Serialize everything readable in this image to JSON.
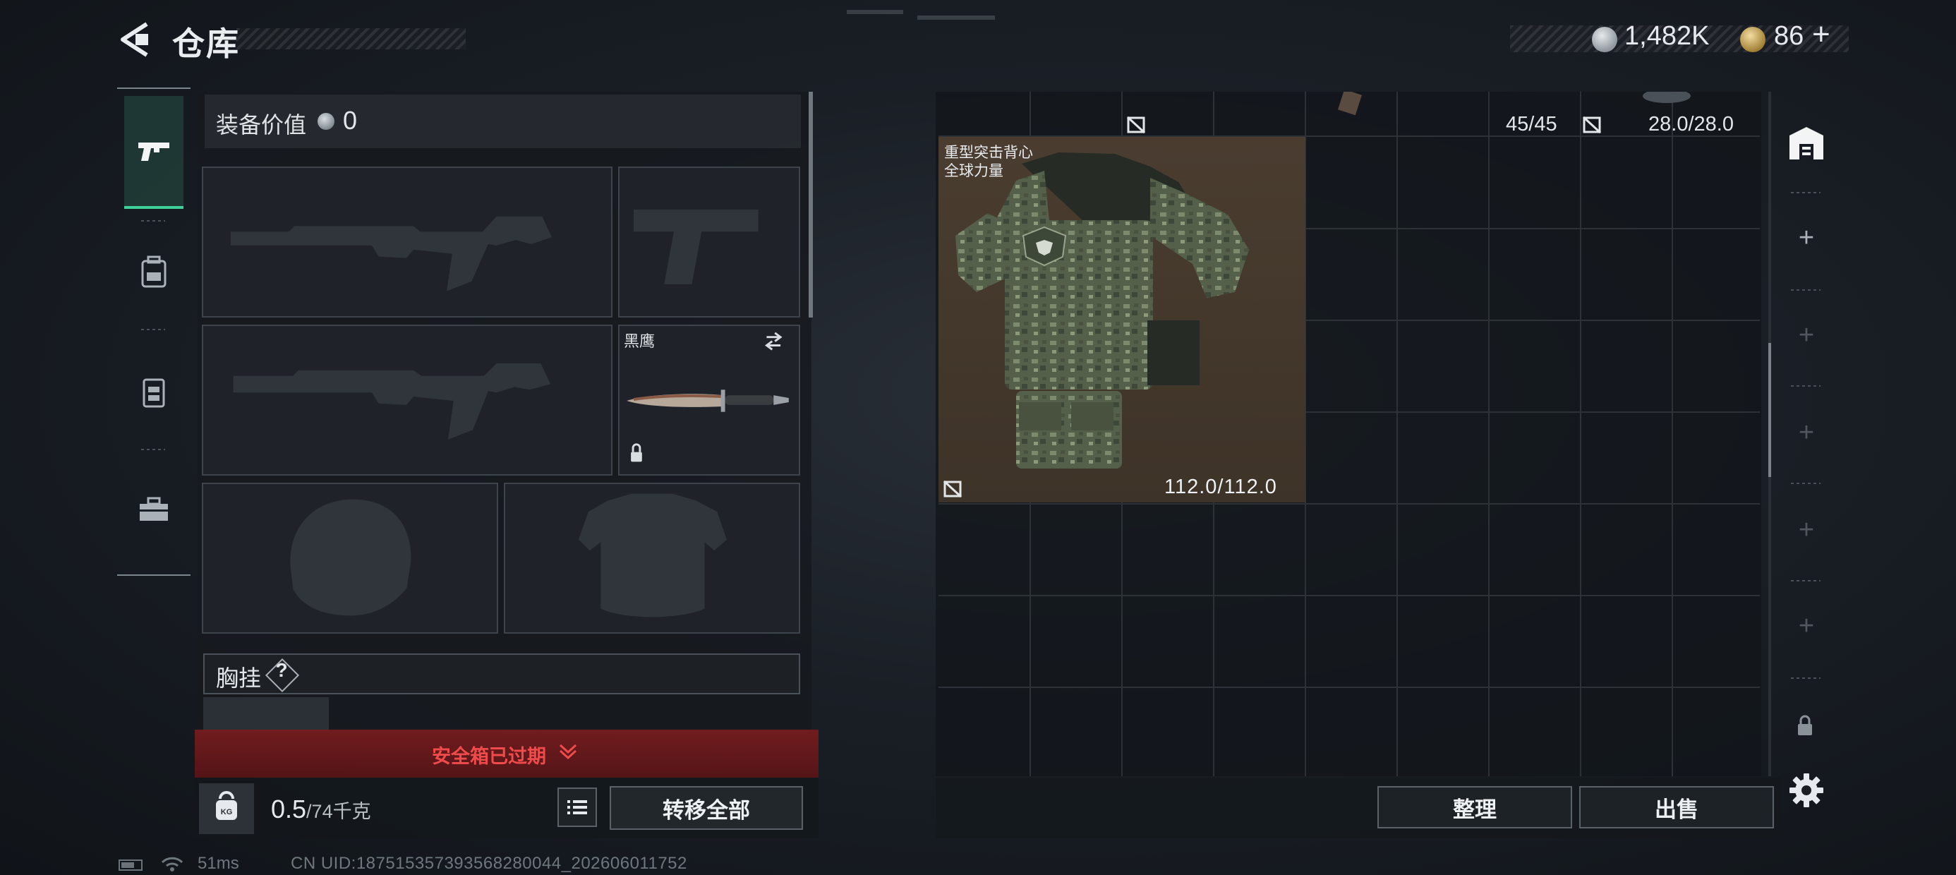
{
  "header": {
    "title": "仓库",
    "currency_silver": "1,482K",
    "currency_gold": "86",
    "currency_gold_plus": "+"
  },
  "tabs": [
    {
      "name": "weapons",
      "active": true
    },
    {
      "name": "backpack",
      "active": false
    },
    {
      "name": "chest-rig",
      "active": false
    },
    {
      "name": "toolbox",
      "active": false
    }
  ],
  "equipment": {
    "value_label": "装备价值",
    "value": "0",
    "knife_name": "黑鹰",
    "chest_label": "胸挂",
    "chest_help": "?"
  },
  "safebox": {
    "warning": "安全箱已过期"
  },
  "bottom": {
    "weight": "0.5",
    "weight_max": "/74千克",
    "transfer_all": "转移全部"
  },
  "stash": {
    "ammo_count": "45/45",
    "armor_top": "28.0/28.0",
    "vest_name_line1": "重型突击背心",
    "vest_name_line2": "全球力量",
    "vest_durability": "112.0/112.0",
    "sort_button": "整理",
    "sell_button": "出售"
  },
  "status": {
    "ping": "51ms",
    "uid": "CN UID:187515357393568280044_202606011752"
  },
  "colors": {
    "accent_green": "#3fd19a",
    "warning_red": "#f04b4b",
    "vest_cell": "#4a3d30"
  }
}
